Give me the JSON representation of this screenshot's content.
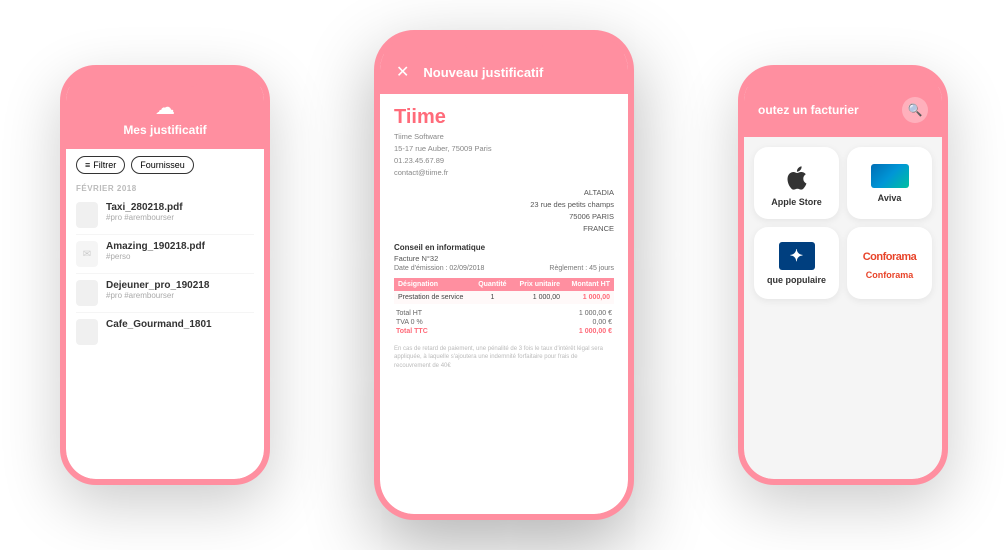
{
  "left_phone": {
    "header_title": "Mes justificatif",
    "cloud_symbol": "☁",
    "filter_label": "Filtrer",
    "supplier_label": "Fournisseu",
    "month": "FÉVRIER 2018",
    "files": [
      {
        "name": "Taxi_280218.pdf",
        "tags": "#pro #arembourser",
        "icon": "doc"
      },
      {
        "name": "Amazing_190218.pdf",
        "tags": "#perso",
        "icon": "envelope"
      },
      {
        "name": "Dejeuner_pro_190218",
        "tags": "#pro #arembourser",
        "icon": "doc"
      },
      {
        "name": "Cafe_Gourmand_1801",
        "tags": "",
        "icon": "doc"
      }
    ]
  },
  "center_phone": {
    "close_symbol": "✕",
    "header_title": "Nouveau justificatif",
    "invoice": {
      "brand": "Tiime",
      "company_line1": "Tiime Software",
      "company_line2": "15-17 rue Auber, 75009 Paris",
      "company_line3": "01.23.45.67.89",
      "company_line4": "contact@tiime.fr",
      "recipient_line1": "ALTADIA",
      "recipient_line2": "23 rue des petits champs",
      "recipient_line3": "75006  PARIS",
      "recipient_line4": "FRANCE",
      "conseil_label": "Conseil en informatique",
      "facture_label": "Facture N°32",
      "date_label": "Date d'émission : 02/09/2018",
      "reglement_label": "Règlement : 45 jours",
      "table_headers": [
        "Désignation",
        "Quantité",
        "Prix unitaire",
        "Montant HT"
      ],
      "table_rows": [
        [
          "Prestation de service",
          "1",
          "1 000,00",
          "1 000,00"
        ]
      ],
      "totals": [
        {
          "label": "Total HT",
          "value": "1 000,00 €"
        },
        {
          "label": "TVA 0 %",
          "value": "0,00 €"
        },
        {
          "label": "Total TTC",
          "value": "1 000,00 €",
          "main": true
        }
      ],
      "footer_note": "En cas de retard de paiement, une pénalité de 3 fois le taux d'intérêt légal sera appliquée, à laquelle s'ajoutera une indemnité forfaitaire pour frais de recouvrement de 40€"
    }
  },
  "right_phone": {
    "header_title": "outez un facturier",
    "search_symbol": "🔍",
    "suppliers": [
      {
        "name": "Apple Store",
        "logo_type": "apple"
      },
      {
        "name": "Aviva",
        "logo_type": "aviva"
      },
      {
        "name": "que populaire",
        "logo_type": "banque"
      },
      {
        "name": "Conforama",
        "logo_type": "conforama"
      }
    ]
  },
  "colors": {
    "pink": "#ff8fa0",
    "pink_dark": "#ff6b7a",
    "white": "#ffffff",
    "text_dark": "#333333",
    "text_light": "#aaaaaa"
  }
}
